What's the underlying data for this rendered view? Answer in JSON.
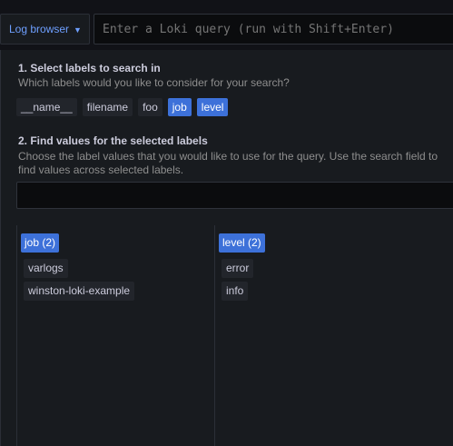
{
  "toolbar": {
    "log_browser_label": "Log browser",
    "query_placeholder": "Enter a Loki query (run with Shift+Enter)"
  },
  "step1": {
    "title": "1. Select labels to search in",
    "description": "Which labels would you like to consider for your search?",
    "labels": [
      {
        "name": "__name__",
        "selected": false
      },
      {
        "name": "filename",
        "selected": false
      },
      {
        "name": "foo",
        "selected": false
      },
      {
        "name": "job",
        "selected": true
      },
      {
        "name": "level",
        "selected": true
      }
    ]
  },
  "step2": {
    "title": "2. Find values for the selected labels",
    "description_line1": "Choose the label values that you would like to use for the query. Use the search field to",
    "description_line2": "find values across selected labels.",
    "search_value": ""
  },
  "value_columns": [
    {
      "header": "job (2)",
      "values": [
        "varlogs",
        "winston-loki-example"
      ]
    },
    {
      "header": "level (2)",
      "values": [
        "error",
        "info"
      ]
    }
  ],
  "colors": {
    "accent": "#3d71d9",
    "link": "#6e9fff",
    "background": "#111217",
    "panel": "#181b1f"
  }
}
